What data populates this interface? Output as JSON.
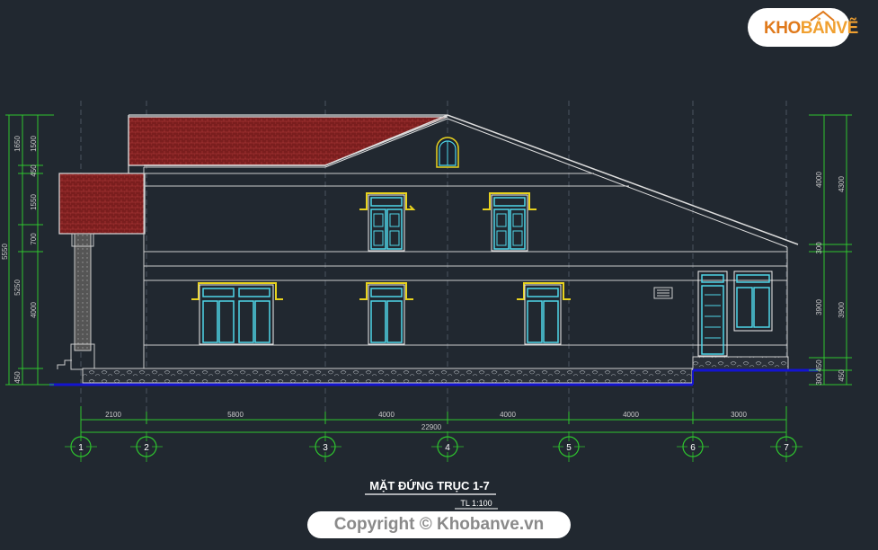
{
  "logo": {
    "text_a": "KHO",
    "text_b": "BẢNVẼ"
  },
  "drawing": {
    "title": "MẶT ĐỨNG TRỤC 1-7",
    "scale": "TL 1:100"
  },
  "axes": [
    "1",
    "2",
    "3",
    "4",
    "5",
    "6",
    "7"
  ],
  "bottom_dims": [
    "2100",
    "5800",
    "4000",
    "4000",
    "4000",
    "3000"
  ],
  "total_dim": "22900",
  "left_dims": {
    "outer": "5550",
    "middle": "5250",
    "inner": [
      "1650",
      "450",
      "1550",
      "700",
      "4000",
      "450"
    ],
    "inner2": [
      "1500",
      "1500",
      "4000"
    ]
  },
  "right_dims": {
    "upper": [
      "4000",
      "4300"
    ],
    "mid": "300",
    "lower": [
      "3900",
      "3900"
    ],
    "bottom": [
      "450",
      "300",
      "450"
    ]
  },
  "copyright": "Copyright © Khobanve.vn",
  "colors": {
    "background": "#212830",
    "roof_tile": "#7a1e1e",
    "window_frame": "#4fd6e8",
    "window_trim": "#e8d21e",
    "dimension": "#2ec52e",
    "ground": "#1414d0"
  }
}
